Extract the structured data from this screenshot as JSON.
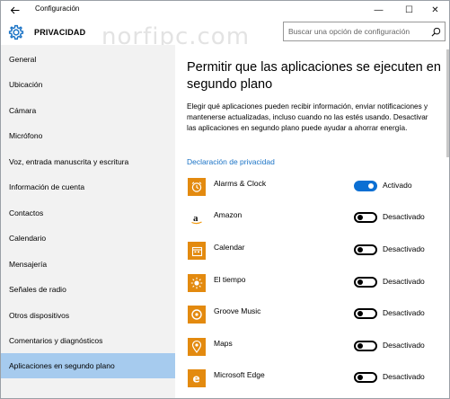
{
  "window": {
    "title": "Configuración",
    "back_icon": "back-arrow-icon",
    "controls": {
      "minimize": "—",
      "maximize": "☐",
      "close": "✕"
    }
  },
  "header": {
    "icon": "gear-icon",
    "section": "PRIVACIDAD",
    "watermark": "norfipc.com",
    "search_placeholder": "Buscar una opción de configuración"
  },
  "sidebar": {
    "active_index": 13,
    "items": [
      {
        "label": "General"
      },
      {
        "label": "Ubicación"
      },
      {
        "label": "Cámara"
      },
      {
        "label": "Micrófono"
      },
      {
        "label": "Voz, entrada manuscrita y escritura"
      },
      {
        "label": "Información de cuenta"
      },
      {
        "label": "Contactos"
      },
      {
        "label": "Calendario"
      },
      {
        "label": "Mensajería"
      },
      {
        "label": "Señales de radio"
      },
      {
        "label": "Otros dispositivos"
      },
      {
        "label": "Comentarios y diagnósticos"
      },
      {
        "label": "Aplicaciones en segundo plano"
      }
    ]
  },
  "main": {
    "heading": "Permitir que las aplicaciones se ejecuten en segundo plano",
    "description": "Elegir qué aplicaciones pueden recibir información, enviar notificaciones y mantenerse actualizadas, incluso cuando no las estés usando. Desactivar las aplicaciones en segundo plano puede ayudar a ahorrar energía.",
    "privacy_link": "Declaración de privacidad",
    "apps": [
      {
        "name": "Alarms & Clock",
        "icon": "alarm-clock-icon",
        "on": true,
        "status": "Activado"
      },
      {
        "name": "Amazon",
        "icon": "amazon-icon",
        "on": false,
        "status": "Desactivado"
      },
      {
        "name": "Calendar",
        "icon": "calendar-icon",
        "on": false,
        "status": "Desactivado"
      },
      {
        "name": "El tiempo",
        "icon": "weather-sun-icon",
        "on": false,
        "status": "Desactivado"
      },
      {
        "name": "Groove Music",
        "icon": "music-disc-icon",
        "on": false,
        "status": "Desactivado"
      },
      {
        "name": "Maps",
        "icon": "map-pin-icon",
        "on": false,
        "status": "Desactivado"
      },
      {
        "name": "Microsoft Edge",
        "icon": "edge-browser-icon",
        "on": false,
        "status": "Desactivado"
      }
    ]
  },
  "colors": {
    "accent": "#0b6fd3",
    "app_tile": "#e38a0f",
    "sidebar_bg": "#f2f2f2",
    "sidebar_active": "#a6cbee",
    "link": "#1a73c6"
  }
}
